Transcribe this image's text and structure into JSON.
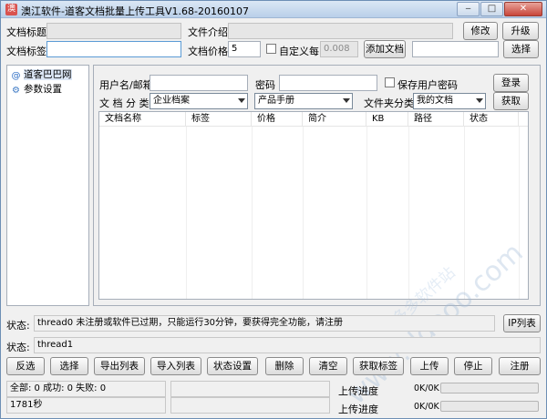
{
  "window": {
    "title": "澳江软件-道客文档批量上传工具V1.68-20160107",
    "controls": {
      "minimize": "‒",
      "maximize": "□",
      "close": "✕"
    }
  },
  "top": {
    "doc_title_label": "文档标题",
    "doc_title_value": "",
    "doc_intro_label": "文件介绍",
    "doc_intro_value": "",
    "modify_button": "修改",
    "upgrade_button": "升级",
    "doc_tags_label": "文档标签",
    "doc_tags_value": "",
    "doc_price_label": "文档价格",
    "doc_price_value": "5",
    "custom_per_k_label": "自定义每K",
    "custom_per_k_value": "0.008",
    "add_doc_button": "添加文档",
    "select_button": "选择",
    "select_field_value": ""
  },
  "sidebar": {
    "items": [
      {
        "label": "道客巴巴网",
        "icon": "at-sign-icon",
        "selected": true
      },
      {
        "label": "参数设置",
        "icon": "gear-icon",
        "selected": false
      }
    ]
  },
  "login": {
    "username_label": "用户名/邮箱",
    "username_value": "",
    "password_label": "密码",
    "password_value": "",
    "save_password_label": "保存用户密码",
    "login_button": "登录",
    "doc_category_label": "文 档 分 类",
    "doc_category_value": "企业档案",
    "doc_subcategory_value": "产品手册",
    "folder_category_label": "文件夹分类",
    "folder_value": "我的文档",
    "fetch_button": "获取"
  },
  "table": {
    "columns": [
      "文档名称",
      "标签",
      "价格",
      "简介",
      "KB",
      "路径",
      "状态"
    ],
    "rows": []
  },
  "watermark": {
    "main": "www.ddooo.com",
    "small": "多多软件站"
  },
  "status": {
    "label1": "状态:",
    "text1": "thread0 未注册或软件已过期，只能运行30分钟，要获得完全功能，请注册",
    "ip_list_button": "IP列表",
    "label2": "状态:",
    "text2": "thread1"
  },
  "toolbar": {
    "buttons": [
      "反选",
      "选择",
      "导出列表",
      "导入列表",
      "状态设置",
      "删除",
      "清空",
      "获取标签",
      "上传",
      "停止",
      "注册"
    ]
  },
  "footer": {
    "counts_text": "全部: 0 成功: 0 失败: 0",
    "time_text": "1781秒",
    "upload_progress_label_1": "上传进度",
    "upload_progress_label_2": "上传进度",
    "progress_value_1": "0K/0K",
    "progress_value_2": "0K/0K",
    "progress_fraction_1": 0,
    "progress_fraction_2": 0
  }
}
